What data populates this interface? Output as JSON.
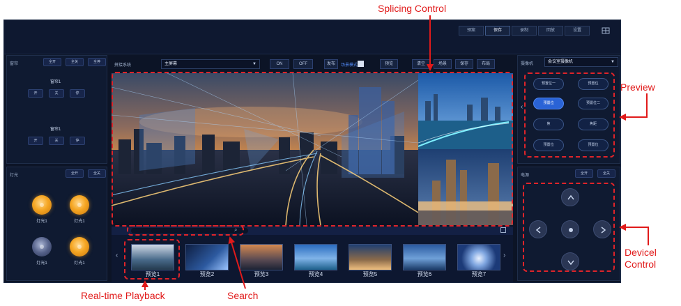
{
  "annotations": {
    "splicing_control": "Splicing Control",
    "preview": "Preview",
    "device_control_line1": "Devicel",
    "device_control_line2": "Control",
    "realtime_playback": "Real-time Playback",
    "search": "Search"
  },
  "colors": {
    "annotation_red": "#e11a1a",
    "active_blue": "#2a63d6",
    "bulb_on": "#f5a623",
    "app_bg": "#0c1426"
  },
  "top_nav": {
    "buttons": [
      "预案",
      "保存",
      "录制",
      "回放",
      "设置"
    ],
    "active_index": 1,
    "menu_icon": "grid-icon"
  },
  "curtain_panel": {
    "title": "窗帘",
    "actions": [
      "全开",
      "全关",
      "全停"
    ],
    "groups": [
      {
        "name": "窗帘1",
        "buttons": [
          "开",
          "关",
          "停"
        ]
      },
      {
        "name": "窗帘1",
        "buttons": [
          "开",
          "关",
          "停"
        ]
      }
    ]
  },
  "lighting_panel": {
    "title": "灯光",
    "actions": [
      "全开",
      "全关"
    ],
    "lights": [
      {
        "label": "灯光1",
        "on": true
      },
      {
        "label": "灯光1",
        "on": true
      },
      {
        "label": "灯光1",
        "on": false
      },
      {
        "label": "灯光1",
        "on": true
      }
    ]
  },
  "splice_toolbar": {
    "system_label": "拼接系统",
    "screen_select": "主屏幕",
    "on": "ON",
    "off": "OFF",
    "publish": "发布",
    "mode_label": "场景模式",
    "preview": "预览",
    "clear": "清空",
    "scene": "场景",
    "save": "保存",
    "layout": "布局"
  },
  "thumbnails": [
    "预览1",
    "预览2",
    "预览3",
    "预览4",
    "预览5",
    "预览6",
    "预览7"
  ],
  "camera_panel": {
    "title": "摄像机",
    "select": "会议室摄像机",
    "presets": [
      "预置位一",
      "预置位",
      "预置位",
      "预置位二",
      "焦",
      "焦距",
      "预置位",
      "预置位"
    ],
    "active_preset": 2
  },
  "power_panel": {
    "title": "电源",
    "actions": [
      "全开",
      "全关"
    ]
  }
}
